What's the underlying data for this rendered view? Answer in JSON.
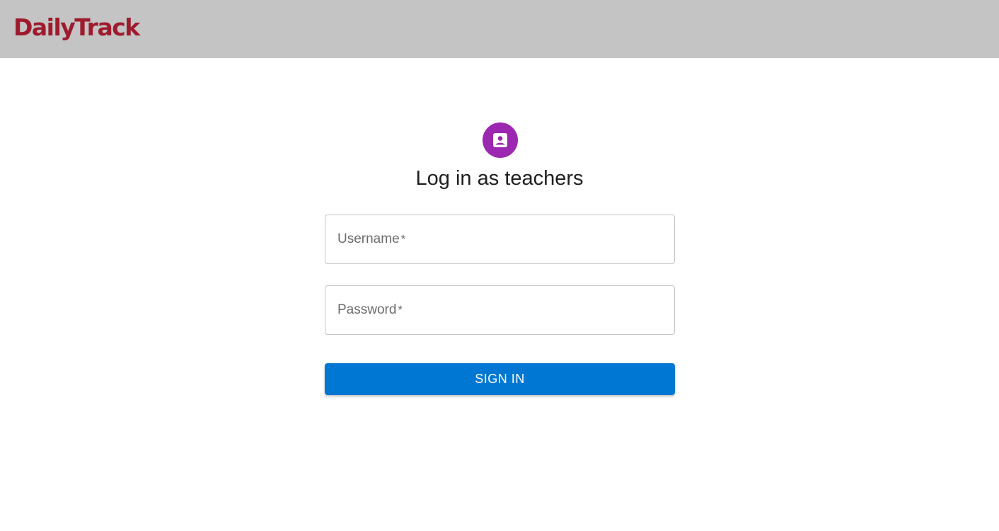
{
  "header": {
    "logo_text": "DailyTrack",
    "brand_color": "#9e1b2e",
    "background": "#c4c4c4"
  },
  "login": {
    "avatar_icon": "account-box-icon",
    "avatar_color": "#9c27b0",
    "title": "Log in as teachers",
    "username": {
      "label": "Username",
      "required_marker": "*",
      "value": ""
    },
    "password": {
      "label": "Password",
      "required_marker": "*",
      "value": ""
    },
    "submit_label": "SIGN IN",
    "submit_color": "#0077d2"
  }
}
